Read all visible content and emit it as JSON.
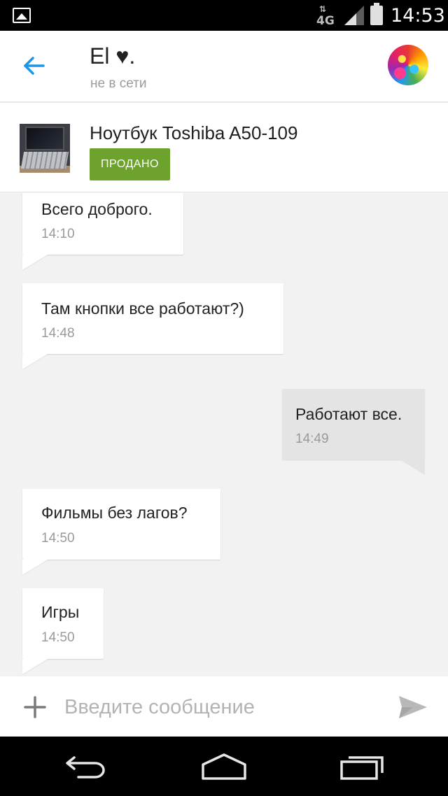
{
  "status_bar": {
    "network": "4G",
    "time": "14:53",
    "icons": [
      "image-notification-icon",
      "network-4g-icon",
      "signal-icon",
      "battery-icon"
    ]
  },
  "header": {
    "contact_name": "El ♥.",
    "contact_status": "не в сети",
    "icons": [
      "back-arrow-icon",
      "avatar"
    ]
  },
  "listing": {
    "title": "Ноутбук Toshiba A50-109",
    "badge": "ПРОДАНО"
  },
  "messages": [
    {
      "direction": "incoming",
      "text": "Всего доброго.",
      "time": "14:10"
    },
    {
      "direction": "incoming",
      "text": "Там кнопки все работают?)",
      "time": "14:48"
    },
    {
      "direction": "outgoing",
      "text": "Работают все.",
      "time": "14:49"
    },
    {
      "direction": "incoming",
      "text": "Фильмы без лагов?",
      "time": "14:50"
    },
    {
      "direction": "incoming",
      "text": "Игры",
      "time": "14:50"
    }
  ],
  "composer": {
    "placeholder": "Введите сообщение",
    "value": "",
    "icons": [
      "plus-icon",
      "send-icon"
    ]
  },
  "nav_bar": {
    "icons": [
      "back-nav-icon",
      "home-nav-icon",
      "recents-nav-icon"
    ]
  },
  "colors": {
    "accent": "#2196f3",
    "sold_badge": "#6da22d",
    "chat_background": "#f2f2f2",
    "outgoing_bubble": "#e4e4e4",
    "incoming_bubble": "#ffffff"
  }
}
